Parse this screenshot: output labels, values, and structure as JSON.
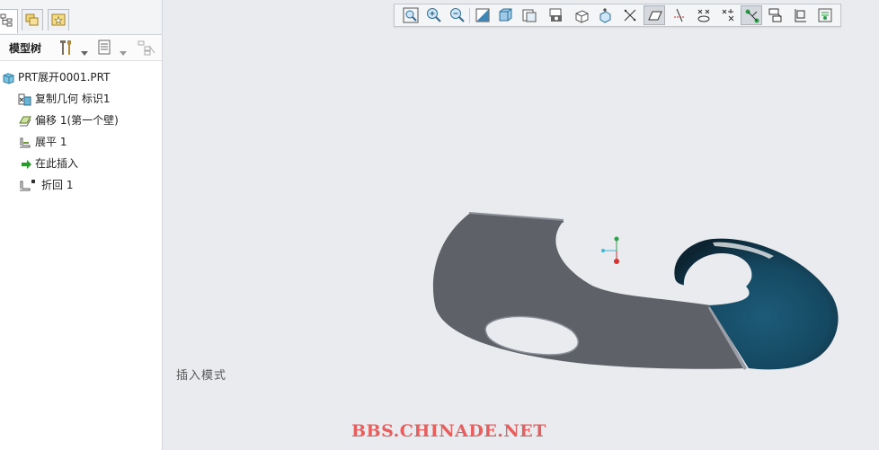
{
  "panel": {
    "tabs": [
      {
        "icon": "model-tree-tab-icon"
      },
      {
        "icon": "folder-browser-tab-icon"
      },
      {
        "icon": "favorites-tab-icon"
      }
    ],
    "tree_title": "模型树",
    "tree_items": [
      {
        "label": "PRT展开0001.PRT",
        "icon": "part-icon"
      },
      {
        "label": "复制几何 标识1",
        "icon": "copy-geometry-icon"
      },
      {
        "label": "偏移 1(第一个壁)",
        "icon": "offset-wall-icon"
      },
      {
        "label": "展平 1",
        "icon": "unbend-icon"
      },
      {
        "label": "在此插入",
        "icon": "insert-here-arrow-icon"
      },
      {
        "label": "折回 1",
        "icon": "bend-back-icon"
      }
    ]
  },
  "mode_text": "插入模式",
  "watermark": "BBS.CHINADE.NET",
  "toolbar": {
    "buttons": [
      "refit-icon",
      "zoom-in-icon",
      "zoom-out-icon",
      "repaint-icon",
      "display-style-icon",
      "saved-views-icon",
      "view-manager-icon",
      "perspective-icon",
      "spin-center-icon",
      "datum-display-icon",
      "plane-display-icon",
      "axis-display-icon",
      "point-display-icon",
      "csys-display-icon",
      "annotation-display-icon",
      "bend-line-icon",
      "flat-state-icon",
      "sheetmetal-setup-icon",
      "appearance-icon"
    ],
    "active": [
      "plane-display-icon",
      "annotation-display-icon"
    ]
  },
  "colors": {
    "flat_face": "#5e6168",
    "flat_edge": "#8a8e96",
    "curved_dark": "#0e2330",
    "curved_mid": "#164a63",
    "viewport_bg": "#e9ebee",
    "watermark": "#e55f5f"
  }
}
